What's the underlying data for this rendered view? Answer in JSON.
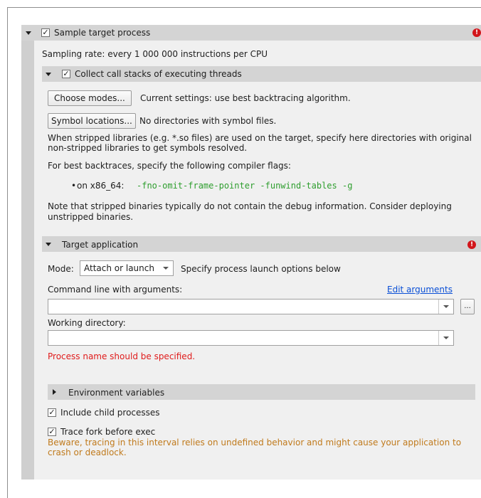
{
  "sample_target": {
    "checked": "✓",
    "label": "Sample target process"
  },
  "sampling_rate": "Sampling rate:  every 1 000 000 instructions per CPU",
  "call_stacks": {
    "checked": "✓",
    "label": "Collect call stacks of executing threads",
    "choose_modes_button": "Choose modes...",
    "current_settings": "Current settings: use best backtracing algorithm.",
    "symbol_locations_button": "Symbol locations...",
    "symbol_status": "No directories with symbol files.",
    "stripped_note": "When stripped libraries (e.g. *.so files) are used on the target, specify here directories with original non-stripped libraries to get symbols resolved.",
    "compiler_flags_intro": "For best backtraces, specify the following compiler flags:",
    "bullet": "•",
    "flags_arch": "on x86_64:",
    "flags": "-fno-omit-frame-pointer -funwind-tables -g",
    "debug_note": "Note that stripped binaries typically do not contain the debug information. Consider deploying unstripped binaries."
  },
  "target_app": {
    "label": "Target application",
    "mode_label": "Mode:",
    "mode_value": "Attach or launch",
    "mode_hint": "Specify process launch options below",
    "cmdline_label": "Command line with arguments:",
    "edit_arguments": "Edit arguments",
    "cmdline_value": "",
    "browse_button": "...",
    "workdir_label": "Working directory:",
    "workdir_value": "",
    "error_text": "Process name should be specified."
  },
  "env_vars": {
    "label": "Environment variables"
  },
  "include_child": {
    "checked": "✓",
    "label": "Include child processes"
  },
  "trace_fork": {
    "checked": "✓",
    "label": "Trace fork before exec",
    "warning": "Beware, tracing in this interval relies on undefined behavior and might cause your application to crash or deadlock."
  },
  "error_icon_glyph": "!"
}
